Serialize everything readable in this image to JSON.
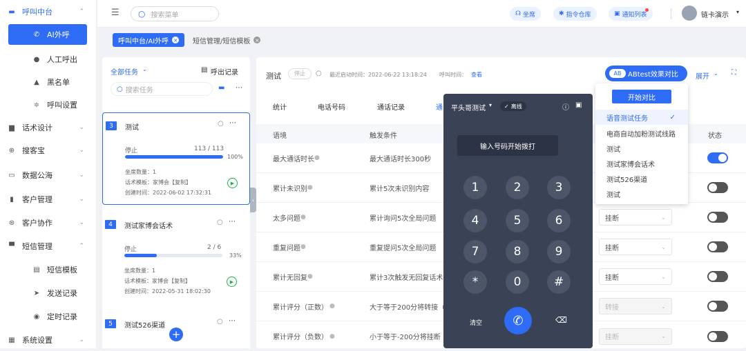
{
  "sidebar": {
    "items": [
      {
        "label": "呼叫中台",
        "icon": "monitor-icon",
        "chev": "^",
        "kind": "top"
      },
      {
        "label": "AI外呼",
        "icon": "phone-icon",
        "kind": "active"
      },
      {
        "label": "人工呼出",
        "icon": "user-icon",
        "kind": "sub"
      },
      {
        "label": "黑名单",
        "icon": "warning-icon",
        "kind": "sub"
      },
      {
        "label": "呼叫设置",
        "icon": "settings-icon",
        "kind": "sub"
      },
      {
        "label": "话术设计",
        "icon": "script-icon",
        "chev": "v",
        "kind": "top"
      },
      {
        "label": "搜客宝",
        "icon": "search-icon",
        "chev": "v",
        "kind": "top"
      },
      {
        "label": "数据公海",
        "icon": "data-icon",
        "chev": "v",
        "kind": "top"
      },
      {
        "label": "客户管理",
        "icon": "customer-icon",
        "chev": "v",
        "kind": "top"
      },
      {
        "label": "客户协作",
        "icon": "collab-icon",
        "chev": "v",
        "kind": "top"
      },
      {
        "label": "短信管理",
        "icon": "message-icon",
        "chev": "^",
        "kind": "top"
      },
      {
        "label": "短信模板",
        "icon": "template-icon",
        "kind": "sub"
      },
      {
        "label": "发送记录",
        "icon": "send-icon",
        "kind": "sub"
      },
      {
        "label": "定时记录",
        "icon": "timer-icon",
        "kind": "sub"
      },
      {
        "label": "系统设置",
        "icon": "grid-icon",
        "chev": "v",
        "kind": "top"
      }
    ]
  },
  "header": {
    "search_placeholder": "搜索菜单",
    "btn_seat": "坐席",
    "btn_command": "指令仓库",
    "btn_notify": "通知列表",
    "user": "链卡演示"
  },
  "tabs": {
    "active": "呼叫中台/AI外呼",
    "other": "短信管理/短信模板"
  },
  "left": {
    "all_tasks": "全部任务",
    "call_log": "呼出记录",
    "search_placeholder": "搜索任务",
    "cards": [
      {
        "num": "3",
        "title": "测试",
        "status": "停止",
        "count": "113 / 113",
        "pct": "100%",
        "fill": 1.0,
        "seats": "坐席数量：1",
        "template": "话术模板：家博会【复制】",
        "created": "创建时间：2022-06-02 17:32:31"
      },
      {
        "num": "4",
        "title": "测试家博会话术",
        "status": "停止",
        "count": "2 / 6",
        "pct": "33%",
        "fill": 0.33,
        "seats": "坐席数量：1",
        "template": "话术模板：家博会【复制】",
        "created": "创建时间：2022-05-31 18:02:30"
      },
      {
        "num": "5",
        "title": "测试526渠道"
      }
    ]
  },
  "main": {
    "title": "测试",
    "status": "停止",
    "recent_label": "最近启动时间：2022-06-22 13:18:24",
    "call_time_label": "呼叫时间：",
    "view": "查看",
    "ab_btn": "ABtest效果对比",
    "expand": "展开",
    "subtabs": [
      "统计",
      "电话号码",
      "通话记录",
      "通"
    ],
    "col_scene": "语境",
    "col_trigger": "触发条件",
    "col_status": "状态",
    "rows": [
      {
        "scene": "最大通话时长",
        "trigger": "最大通话时长300秒",
        "action": "",
        "on": true
      },
      {
        "scene": "累计未识别",
        "trigger": "累计5次未识别内容",
        "action": "",
        "on": false
      },
      {
        "scene": "太多问题",
        "trigger": "累计询问5次全局问题",
        "action": "挂断",
        "on": false
      },
      {
        "scene": "重复问题",
        "trigger": "重复提问5次全局问题",
        "action": "挂断",
        "on": false
      },
      {
        "scene": "累计无回复",
        "trigger": "累计3次触发无回复话术",
        "action": "挂断",
        "on": false
      },
      {
        "scene": "累计评分（正数）",
        "trigger": "大于等于200分将转接（",
        "action": "转接",
        "on": false
      },
      {
        "scene": "累计评分（负数）",
        "trigger": "小于等于-200分将挂断",
        "action": "挂断",
        "on": false
      }
    ]
  },
  "dialer": {
    "name": "平头哥测试",
    "status": "离线",
    "input": "输入号码开始拨打",
    "keys": [
      "1",
      "2",
      "3",
      "4",
      "5",
      "6",
      "7",
      "8",
      "9",
      "*",
      "0",
      "#"
    ],
    "clear": "清空"
  },
  "dropdown": {
    "start": "开始对比",
    "items": [
      "语音测试任务",
      "电商自动加粉测试线路",
      "测试",
      "测试家博会话术",
      "测试526渠道",
      "测试"
    ]
  },
  "colors": {
    "accent": "#2f6cf6",
    "dialer": "#3a4256"
  }
}
